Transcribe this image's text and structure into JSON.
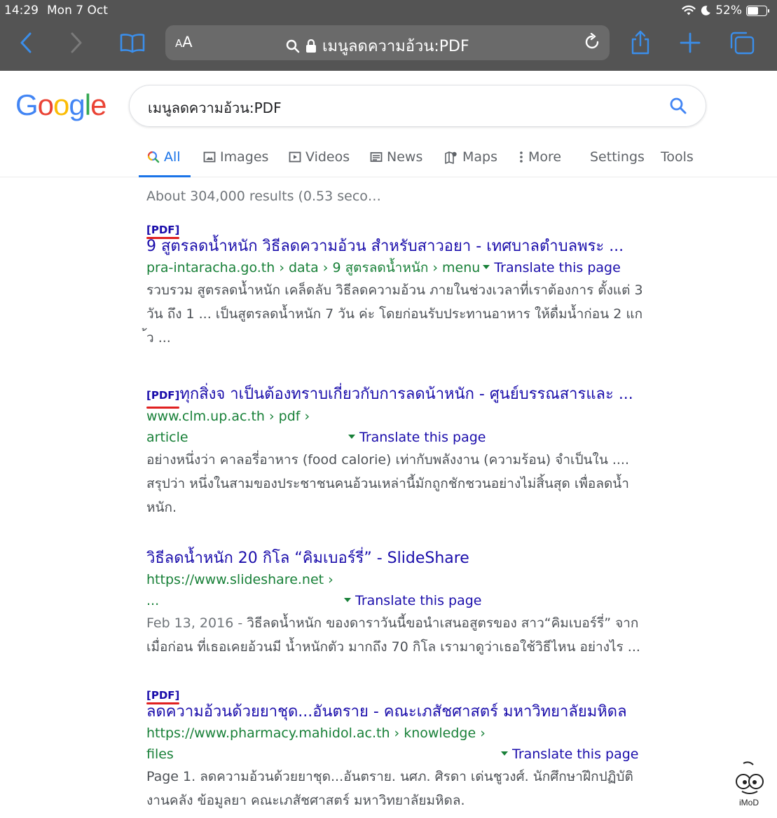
{
  "status_bar": {
    "time": "14:29",
    "date": "Mon 7 Oct",
    "battery": "52%"
  },
  "toolbar": {
    "aa_label_small": "A",
    "aa_label_large": "A",
    "url_text": "เมนูลดความอ้วน:PDF"
  },
  "google": {
    "logo_letters": [
      "G",
      "o",
      "o",
      "g",
      "l",
      "e"
    ],
    "logo_colors": [
      "#4285F4",
      "#EA4335",
      "#FBBC05",
      "#4285F4",
      "#34A853",
      "#EA4335"
    ],
    "query": "เมนูลดความอ้วน:PDF"
  },
  "tabs": {
    "all": "All",
    "images": "Images",
    "videos": "Videos",
    "news": "News",
    "maps": "Maps",
    "more": "More",
    "settings": "Settings",
    "tools": "Tools"
  },
  "stats": "About 304,000 results (0.53 seco…",
  "results": [
    {
      "badge": "[PDF]",
      "title": "9 สูตรลดน้ำหนัก วิธีลดความอ้วน สำหรับสาวอยา - เทศบาลตำบลพระ ...",
      "url": "pra-intaracha.go.th › data › 9 สูตรลดน้ำหนัก › menu",
      "url_line2": "",
      "translate": "Translate this page",
      "snippet_lines": [
        "รวบรวม สูตรลดน้ำหนัก เคล็ดลับ วิธีลดความอ้วน ภายในช่วงเวลาที่เราต้องการ ตั้งแต่ 3",
        "วัน ถึง 1 ... เป็นสูตรลดน้ำหนัก 7 วัน ค่ะ โดยก่อนรับประทานอาหาร ให้ดื่มน้ำก่อน 2 แก",
        "้ว ..."
      ]
    },
    {
      "badge": "[PDF]",
      "title": "ทุกสิ่งจ าเป็นต้องทราบเกี่ยวกับการลดน้าหนัก - ศูนย์บรรณสารและ ...",
      "url": "www.clm.up.ac.th › pdf ›",
      "url_line2": "article",
      "translate": "Translate this page",
      "snippet_lines": [
        "อย่างหนึ่งว่า คาลอรี่อาหาร (food calorie) เท่ากับพลังงาน (ความร้อน) จำเป็นใน ....",
        "สรุปว่า หนึ่งในสามของประชาชนคนอ้วนเหล่านี้มักถูกชักชวนอย่างไม่สิ้นสุด เพื่อลดน้ำ",
        "หนัก."
      ]
    },
    {
      "badge": "",
      "title": "วิธีลดน้ำหนัก 20 กิโล “คิมเบอร์รี่” - SlideShare",
      "url": "https://www.slideshare.net ›",
      "url_line2": "...",
      "translate": "Translate this page",
      "snippet_date": "Feb 13, 2016 - ",
      "snippet_lines": [
        "วิธีลดน้ำหนัก ของดาราวันนี้ขอนำเสนอสูตรของ สาว“คิมเบอร์รี่” จาก",
        "เมื่อก่อน ที่เธอเคยอ้วนมี น้ำหนักตัว มากถึง 70 กิโล เรามาดูว่าเธอใช้วิธีไหน อย่างไร ..."
      ]
    },
    {
      "badge": "[PDF]",
      "title": "ลดความอ้วนด้วยยาชุด...อันตราย - คณะเภสัชศาสตร์ มหาวิทยาลัยมหิดล",
      "url": "https://www.pharmacy.mahidol.ac.th › knowledge ›",
      "url_line2": "files",
      "translate": "Translate this page",
      "snippet_lines": [
        "Page 1. ลดความอ้วนด้วยยาชุด...อันตราย. นศภ. ศิรดา เด่นชูวงศ์. นักศึกษาฝึกปฏิบัติ",
        "งานคลัง ข้อมูลยา คณะเภสัชศาสตร์ มหาวิทยาลัยมหิดล."
      ]
    }
  ],
  "watermark": "iMoD"
}
